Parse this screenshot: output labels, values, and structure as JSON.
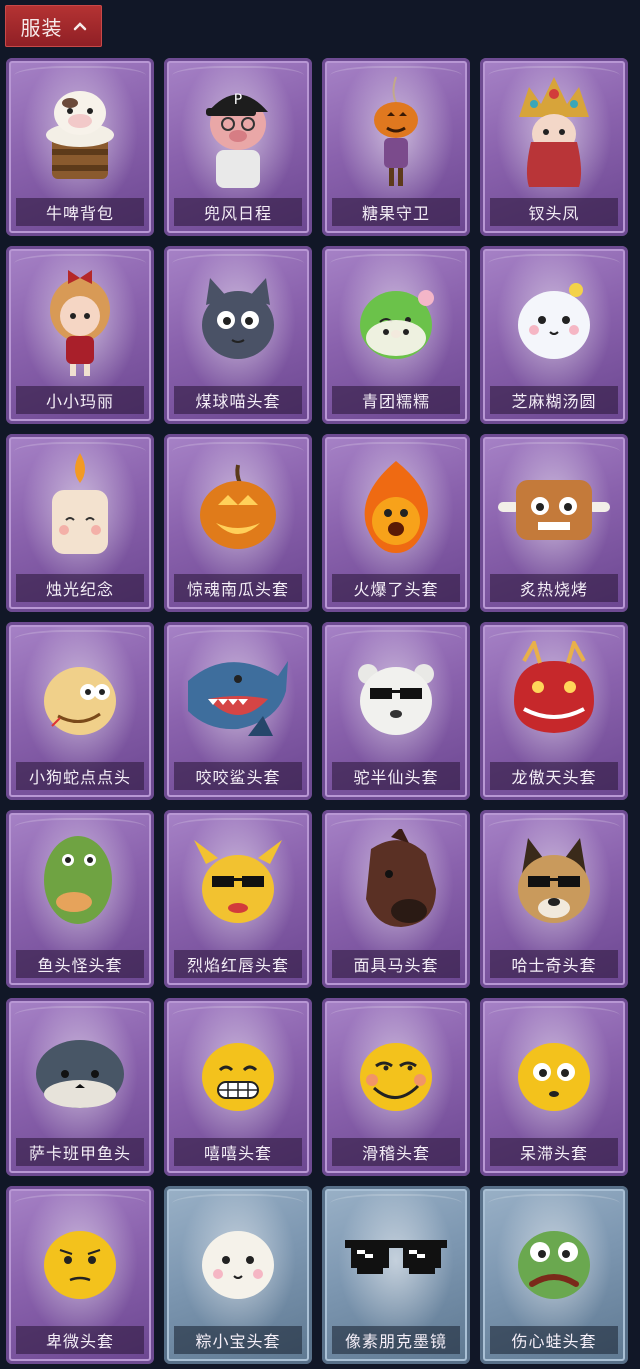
{
  "category": {
    "label": "服装",
    "expanded_icon": "chevron-up-icon"
  },
  "items": [
    {
      "name": "牛啤背包",
      "theme": "purple",
      "icon": "cow-beer-icon"
    },
    {
      "name": "兜风日程",
      "theme": "purple",
      "icon": "pig-cap-icon"
    },
    {
      "name": "糖果守卫",
      "theme": "purple",
      "icon": "pumpkin-doll-icon"
    },
    {
      "name": "钗头凤",
      "theme": "purple",
      "icon": "phoenix-crown-icon"
    },
    {
      "name": "小小玛丽",
      "theme": "purple",
      "icon": "doll-girl-icon"
    },
    {
      "name": "煤球喵头套",
      "theme": "purple",
      "icon": "black-cat-icon"
    },
    {
      "name": "青团糯糯",
      "theme": "purple",
      "icon": "green-dumpling-icon"
    },
    {
      "name": "芝麻糊汤圆",
      "theme": "purple",
      "icon": "white-dumpling-icon"
    },
    {
      "name": "烛光纪念",
      "theme": "purple",
      "icon": "candle-icon"
    },
    {
      "name": "惊魂南瓜头套",
      "theme": "purple",
      "icon": "jack-o-lantern-icon"
    },
    {
      "name": "火爆了头套",
      "theme": "purple",
      "icon": "fire-face-icon"
    },
    {
      "name": "炙热烧烤",
      "theme": "purple",
      "icon": "bbq-meat-icon"
    },
    {
      "name": "小狗蛇点点头",
      "theme": "purple",
      "icon": "snake-dog-icon"
    },
    {
      "name": "咬咬鲨头套",
      "theme": "purple",
      "icon": "shark-icon"
    },
    {
      "name": "驼半仙头套",
      "theme": "purple",
      "icon": "sunglasses-bear-icon"
    },
    {
      "name": "龙傲天头套",
      "theme": "purple",
      "icon": "red-dragon-icon"
    },
    {
      "name": "鱼头怪头套",
      "theme": "purple",
      "icon": "fish-head-icon"
    },
    {
      "name": "烈焰红唇头套",
      "theme": "purple",
      "icon": "yellow-mask-icon"
    },
    {
      "name": "面具马头套",
      "theme": "purple",
      "icon": "horse-mask-icon"
    },
    {
      "name": "哈士奇头套",
      "theme": "purple",
      "icon": "husky-icon"
    },
    {
      "name": "萨卡班甲鱼头",
      "theme": "purple",
      "icon": "armored-fish-icon"
    },
    {
      "name": "嘻嘻头套",
      "theme": "purple",
      "icon": "grin-emoji-icon"
    },
    {
      "name": "滑稽头套",
      "theme": "purple",
      "icon": "smirk-emoji-icon"
    },
    {
      "name": "呆滞头套",
      "theme": "purple",
      "icon": "dazed-emoji-icon"
    },
    {
      "name": "卑微头套",
      "theme": "purple",
      "icon": "humble-emoji-icon"
    },
    {
      "name": "粽小宝头套",
      "theme": "blue",
      "icon": "zongzi-icon"
    },
    {
      "name": "像素朋克墨镜",
      "theme": "blue",
      "icon": "pixel-sunglasses-icon"
    },
    {
      "name": "伤心蛙头套",
      "theme": "blue",
      "icon": "sad-frog-icon"
    }
  ]
}
